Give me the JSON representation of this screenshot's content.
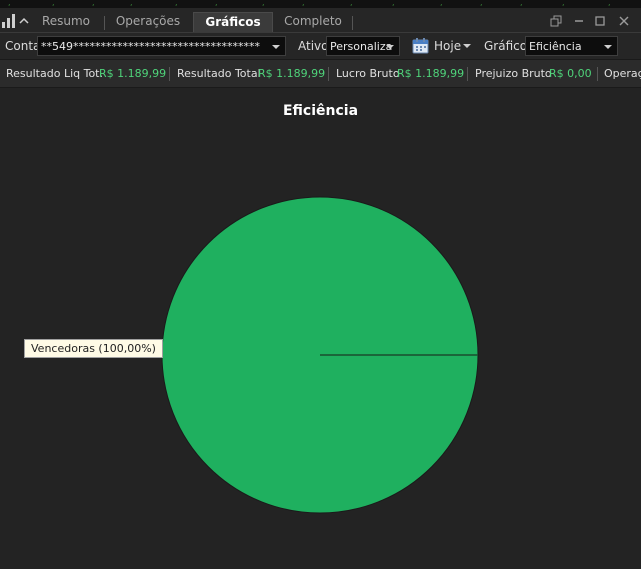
{
  "tabs": [
    {
      "label": "Resumo",
      "active": false
    },
    {
      "label": "Operações",
      "active": false
    },
    {
      "label": "Gráficos",
      "active": true
    },
    {
      "label": "Completo",
      "active": false
    }
  ],
  "toolbar": {
    "conta_label": "Conta",
    "conta_value": "**549**********************************",
    "ativo_label": "Ativo",
    "ativo_value": "Personaliza",
    "periodo_value": "Hoje",
    "grafico_label": "Gráfico",
    "grafico_value": "Eficiência"
  },
  "summary": [
    {
      "label": "Resultado Liq Tot.",
      "value": "R$ 1.189,99"
    },
    {
      "label": "Resultado Total",
      "value": "R$ 1.189,99"
    },
    {
      "label": "Lucro Bruto",
      "value": "R$ 1.189,99"
    },
    {
      "label": "Prejuizo Bruto",
      "value": "R$ 0,00"
    },
    {
      "label": "Operaç",
      "value": ""
    }
  ],
  "icons": {
    "chart": "bar-chart-icon",
    "collapse": "chevron-up-icon",
    "calendar": "calendar-icon",
    "restore": "restore-window-icon",
    "minimize": "minimize-icon",
    "maximize": "maximize-icon",
    "close": "close-icon"
  },
  "colors": {
    "positive": "#4fd37a",
    "pie": "#1fb05f",
    "background": "#232323"
  },
  "chart_data": {
    "type": "pie",
    "title": "Eficiência",
    "slices": [
      {
        "label": "Vencedoras (100,00%)",
        "value": 100,
        "color": "#1fb05f"
      }
    ]
  }
}
